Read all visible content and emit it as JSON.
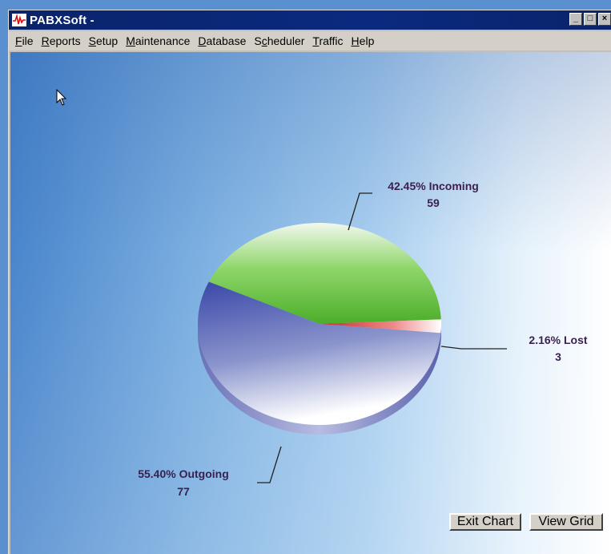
{
  "window": {
    "title": "PABXSoft -",
    "minimize_glyph": "_",
    "maximize_glyph": "□",
    "close_glyph": "×"
  },
  "menu": {
    "items": [
      {
        "accel": "F",
        "rest": "ile"
      },
      {
        "accel": "R",
        "rest": "eports"
      },
      {
        "accel": "S",
        "rest": "etup"
      },
      {
        "accel": "M",
        "rest": "aintenance"
      },
      {
        "accel": "D",
        "rest": "atabase"
      },
      {
        "pre": "S",
        "accel": "c",
        "rest": "heduler"
      },
      {
        "accel": "T",
        "rest": "raffic"
      },
      {
        "accel": "H",
        "rest": "elp"
      }
    ]
  },
  "buttons": {
    "exit_chart": "Exit Chart",
    "view_grid": "View Grid"
  },
  "icons": {
    "app": "pulse-wave-icon",
    "cursor": "mouse-pointer-icon"
  },
  "chart_data": {
    "type": "pie",
    "slices": [
      {
        "name": "Incoming",
        "value": 59,
        "percent": "42.45%",
        "label": "42.45% Incoming",
        "value_label": "59",
        "color": "#5cc23a"
      },
      {
        "name": "Lost",
        "value": 3,
        "percent": "2.16%",
        "label": "2.16% Lost",
        "value_label": "3",
        "color": "#e0403a"
      },
      {
        "name": "Outgoing",
        "value": 77,
        "percent": "55.40%",
        "label": "55.40% Outgoing",
        "value_label": "77",
        "color": "#3a4aa8"
      }
    ]
  }
}
